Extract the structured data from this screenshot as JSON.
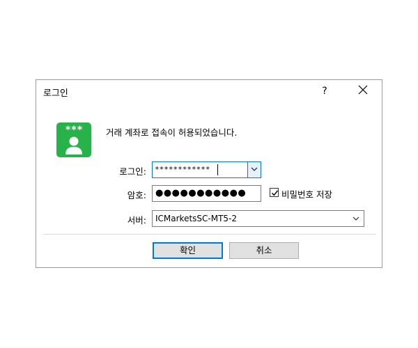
{
  "dialog": {
    "title": "로그인",
    "help_label": "?",
    "message": "거래 계좌로 접속이 허용되었습니다."
  },
  "icons": {
    "app": "login-user-icon",
    "app_text": "***",
    "close": "close-icon",
    "dropdown": "chevron-down-icon",
    "check": "checkmark-icon"
  },
  "colors": {
    "icon_green": "#27b34a",
    "focus_blue": "#0078d7"
  },
  "form": {
    "login_label": "로그인:",
    "login_value": "************",
    "password_label": "암호:",
    "password_value": "●●●●●●●●●●●",
    "save_password_label": "비밀번호 저장",
    "save_password_checked": true,
    "server_label": "서버:",
    "server_value": "ICMarketsSC-MT5-2"
  },
  "buttons": {
    "ok": "확인",
    "cancel": "취소"
  }
}
